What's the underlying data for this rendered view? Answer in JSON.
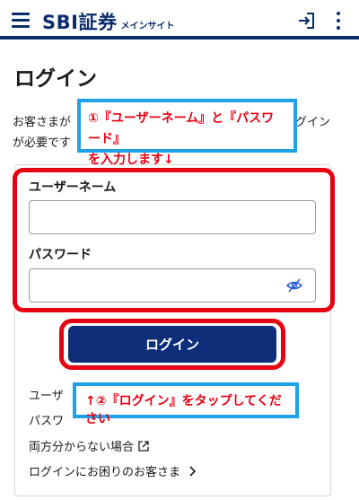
{
  "header": {
    "logo_main": "SBI証券",
    "logo_sub": "メインサイト",
    "icons": [
      "menu-icon",
      "login-icon",
      "more-vertical-icon"
    ],
    "brand_color": "#0b2d6b"
  },
  "page": {
    "title": "ログイン",
    "intro_line1": "お客さまが",
    "intro_line1_end": "グイン",
    "intro_line2": "が必要です"
  },
  "callouts": {
    "step1_line1": "①『ユーザーネーム』と『パスワード』",
    "step1_line2": "を入力します↓",
    "step2": "↑②『ログイン』をタップしてください",
    "text_color": "#e60012",
    "border_color": "#1ea1e8"
  },
  "form": {
    "username_label": "ユーザーネーム",
    "username_value": "",
    "password_label": "パスワード",
    "password_value": "",
    "login_button": "ログイン",
    "button_color": "#0e2e7a"
  },
  "links": {
    "forgot_username": "ユーザ",
    "forgot_password": "パスワ",
    "forgot_both": "両方分からない場合",
    "help": "ログインにお困りのお客さま"
  }
}
